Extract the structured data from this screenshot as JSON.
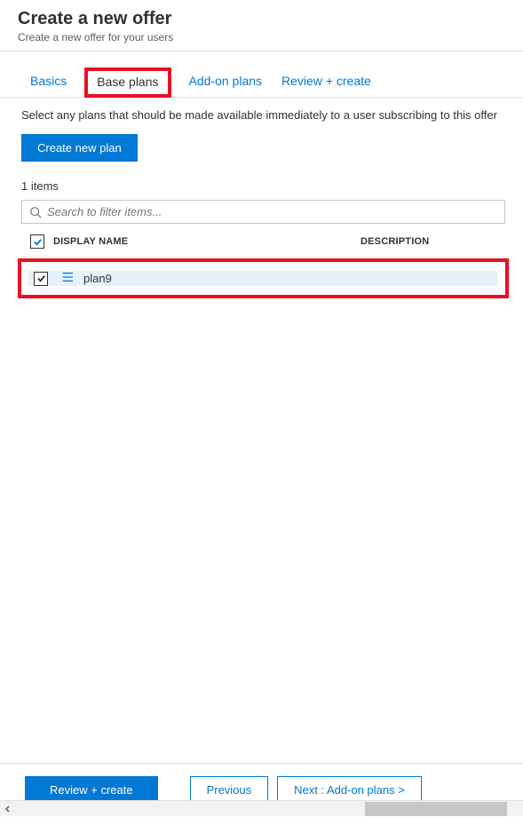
{
  "header": {
    "title": "Create a new offer",
    "subtitle": "Create a new offer for your users"
  },
  "tabs": {
    "basics": "Basics",
    "base_plans": "Base plans",
    "addon_plans": "Add-on plans",
    "review": "Review + create"
  },
  "content": {
    "description": "Select any plans that should be made available immediately to a user subscribing to this offer",
    "create_plan_label": "Create new plan",
    "item_count": "1 items",
    "search_placeholder": "Search to filter items..."
  },
  "table": {
    "columns": {
      "display_name": "DISPLAY NAME",
      "description": "DESCRIPTION"
    },
    "rows": [
      {
        "name": "plan9",
        "description": ""
      }
    ]
  },
  "footer": {
    "review": "Review + create",
    "previous": "Previous",
    "next": "Next : Add-on plans >"
  }
}
